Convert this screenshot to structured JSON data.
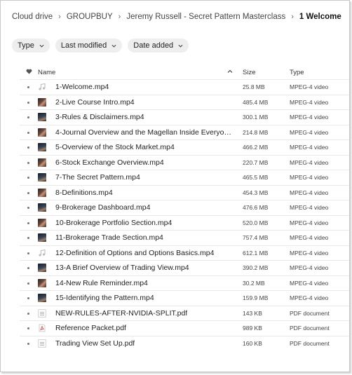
{
  "breadcrumb": {
    "items": [
      "Cloud drive",
      "GROUPBUY",
      "Jeremy Russell - Secret Pattern Masterclass",
      "1 Welcome"
    ]
  },
  "filters": [
    "Type",
    "Last modified",
    "Date added"
  ],
  "table": {
    "headers": {
      "name": "Name",
      "size": "Size",
      "type": "Type"
    },
    "sort": {
      "column": "Name",
      "direction": "ascending"
    },
    "rows": [
      {
        "name": "1-Welcome.mp4",
        "size": "25.8 MB",
        "type": "MPEG-4 video",
        "icon": "music-file-icon"
      },
      {
        "name": "2-Live Course Intro.mp4",
        "size": "485.4 MB",
        "type": "MPEG-4 video",
        "icon": "video-thumbnail-icon"
      },
      {
        "name": "3-Rules & Disclaimers.mp4",
        "size": "300.1 MB",
        "type": "MPEG-4 video",
        "icon": "video-thumbnail-icon"
      },
      {
        "name": "4-Journal Overview and the Magellan Inside Everyone....",
        "size": "214.8 MB",
        "type": "MPEG-4 video",
        "icon": "video-thumbnail-icon"
      },
      {
        "name": "5-Overview of the Stock Market.mp4",
        "size": "466.2 MB",
        "type": "MPEG-4 video",
        "icon": "video-thumbnail-icon"
      },
      {
        "name": "6-Stock Exchange Overview.mp4",
        "size": "220.7 MB",
        "type": "MPEG-4 video",
        "icon": "video-thumbnail-icon"
      },
      {
        "name": "7-The Secret Pattern.mp4",
        "size": "465.5 MB",
        "type": "MPEG-4 video",
        "icon": "video-thumbnail-icon"
      },
      {
        "name": "8-Definitions.mp4",
        "size": "454.3 MB",
        "type": "MPEG-4 video",
        "icon": "video-thumbnail-icon"
      },
      {
        "name": "9-Brokerage Dashboard.mp4",
        "size": "476.6 MB",
        "type": "MPEG-4 video",
        "icon": "video-thumbnail-icon"
      },
      {
        "name": "10-Brokerage Portfolio Section.mp4",
        "size": "520.0 MB",
        "type": "MPEG-4 video",
        "icon": "video-thumbnail-icon"
      },
      {
        "name": "11-Brokerage Trade Section.mp4",
        "size": "757.4 MB",
        "type": "MPEG-4 video",
        "icon": "video-thumbnail-icon"
      },
      {
        "name": "12-Definition of Options and Options Basics.mp4",
        "size": "612.1 MB",
        "type": "MPEG-4 video",
        "icon": "music-file-icon"
      },
      {
        "name": "13-A Brief Overview of Trading View.mp4",
        "size": "390.2 MB",
        "type": "MPEG-4 video",
        "icon": "video-thumbnail-icon"
      },
      {
        "name": "14-New Rule Reminder.mp4",
        "size": "30.2 MB",
        "type": "MPEG-4 video",
        "icon": "video-thumbnail-icon"
      },
      {
        "name": "15-Identifying the Pattern.mp4",
        "size": "159.9 MB",
        "type": "MPEG-4 video",
        "icon": "video-thumbnail-icon"
      },
      {
        "name": "NEW-RULES-AFTER-NVIDIA-SPLIT.pdf",
        "size": "143 KB",
        "type": "PDF document",
        "icon": "document-thumbnail-icon"
      },
      {
        "name": "Reference Packet.pdf",
        "size": "989 KB",
        "type": "PDF document",
        "icon": "pdf-icon"
      },
      {
        "name": "Trading View Set Up.pdf",
        "size": "160 KB",
        "type": "PDF document",
        "icon": "document-thumbnail-icon"
      }
    ]
  },
  "colors": {
    "chip_bg": "#eeeeee",
    "row_divider": "#e9e9e9",
    "text": "#222222",
    "pdf_red": "#d64545"
  }
}
